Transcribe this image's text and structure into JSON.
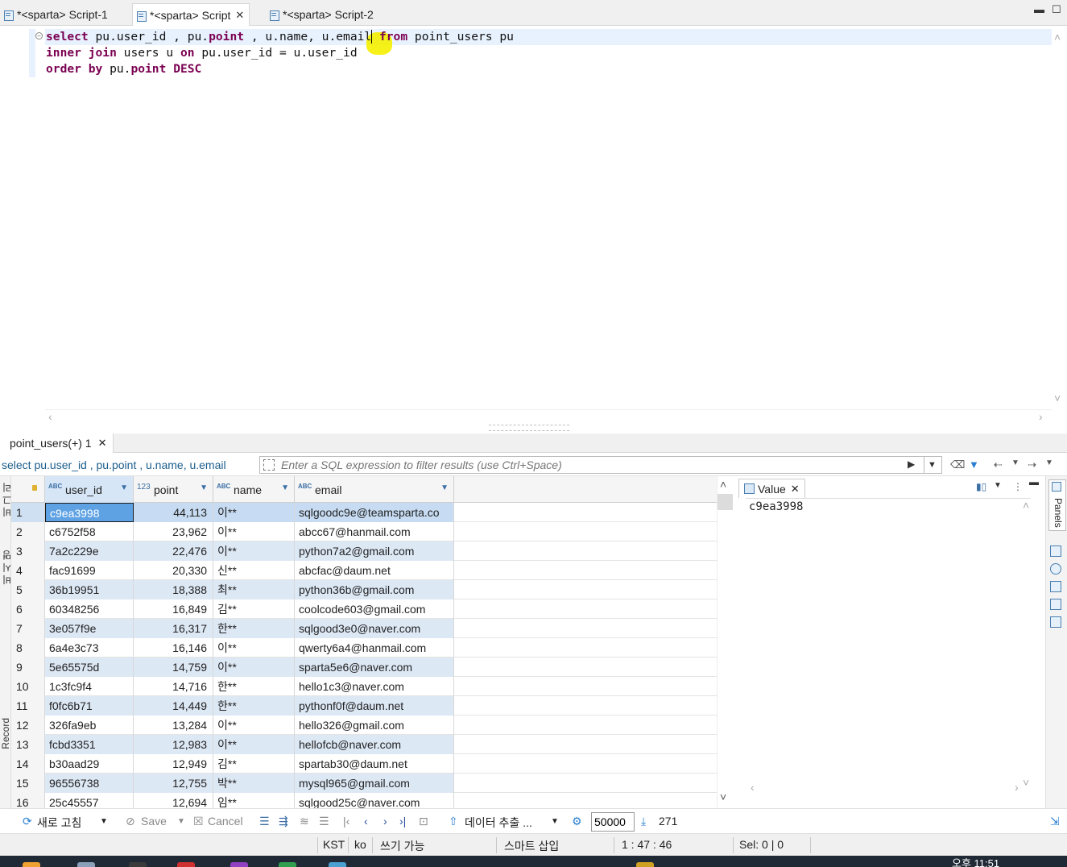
{
  "tabs": [
    {
      "label": "*<sparta> Script-1",
      "active": false,
      "closable": false
    },
    {
      "label": "*<sparta> Script",
      "active": true,
      "closable": true
    },
    {
      "label": "*<sparta> Script-2",
      "active": false,
      "closable": false
    }
  ],
  "editor": {
    "lines": [
      {
        "kw1": "select",
        "t1": " pu.user_id , pu.",
        "kw2": "point",
        "t2": " , u.name, u.email",
        "kw3": "from",
        "t3": " point_users pu"
      },
      {
        "kw1": "inner join",
        "t1": " users u ",
        "kw2": "on",
        "t2": " pu.user_id = u.user_id"
      },
      {
        "kw1": "order by",
        "t1": " pu.",
        "kw2": "point",
        "t2": " ",
        "kw3": "DESC"
      }
    ]
  },
  "results": {
    "tab_label": "point_users(+) 1",
    "query_preview": "select pu.user_id , pu.point , u.name, u.email",
    "filter_placeholder": "Enter a SQL expression to filter results (use Ctrl+Space)",
    "columns": [
      {
        "type": "ABC",
        "name": "user_id"
      },
      {
        "type": "123",
        "name": "point"
      },
      {
        "type": "ABC",
        "name": "name"
      },
      {
        "type": "ABC",
        "name": "email"
      }
    ],
    "rows": [
      {
        "n": "1",
        "user_id": "c9ea3998",
        "point": "44,113",
        "name": "이**",
        "email": "sqlgoodc9e@teamsparta.co"
      },
      {
        "n": "2",
        "user_id": "c6752f58",
        "point": "23,962",
        "name": "이**",
        "email": "abcc67@hanmail.com"
      },
      {
        "n": "3",
        "user_id": "7a2c229e",
        "point": "22,476",
        "name": "이**",
        "email": "python7a2@gmail.com"
      },
      {
        "n": "4",
        "user_id": "fac91699",
        "point": "20,330",
        "name": "신**",
        "email": "abcfac@daum.net"
      },
      {
        "n": "5",
        "user_id": "36b19951",
        "point": "18,388",
        "name": "최**",
        "email": "python36b@gmail.com"
      },
      {
        "n": "6",
        "user_id": "60348256",
        "point": "16,849",
        "name": "김**",
        "email": "coolcode603@gmail.com"
      },
      {
        "n": "7",
        "user_id": "3e057f9e",
        "point": "16,317",
        "name": "한**",
        "email": "sqlgood3e0@naver.com"
      },
      {
        "n": "8",
        "user_id": "6a4e3c73",
        "point": "16,146",
        "name": "이**",
        "email": "qwerty6a4@hanmail.com"
      },
      {
        "n": "9",
        "user_id": "5e65575d",
        "point": "14,759",
        "name": "이**",
        "email": "sparta5e6@naver.com"
      },
      {
        "n": "10",
        "user_id": "1c3fc9f4",
        "point": "14,716",
        "name": "한**",
        "email": "hello1c3@naver.com"
      },
      {
        "n": "11",
        "user_id": "f0fc6b71",
        "point": "14,449",
        "name": "한**",
        "email": "pythonf0f@daum.net"
      },
      {
        "n": "12",
        "user_id": "326fa9eb",
        "point": "13,284",
        "name": "이**",
        "email": "hello326@gmail.com"
      },
      {
        "n": "13",
        "user_id": "fcbd3351",
        "point": "12,983",
        "name": "이**",
        "email": "hellofcb@naver.com"
      },
      {
        "n": "14",
        "user_id": "b30aad29",
        "point": "12,949",
        "name": "김**",
        "email": "spartab30@daum.net"
      },
      {
        "n": "15",
        "user_id": "96556738",
        "point": "12,755",
        "name": "박**",
        "email": "mysql965@gmail.com"
      },
      {
        "n": "16",
        "user_id": "25c45557",
        "point": "12,694",
        "name": "임**",
        "email": "sqlgood25c@naver.com"
      }
    ],
    "selected_row": 0
  },
  "value_panel": {
    "tab_label": "Value",
    "value": "c9ea3998",
    "side_tab_label": "Panels"
  },
  "left_strip": {
    "top_text": "비 그 리",
    "mid_text": "비 시 명",
    "record_label": "Record"
  },
  "toolbar": {
    "refresh_label": "새로 고침",
    "save_label": "Save",
    "cancel_label": "Cancel",
    "export_label": "데이터 추출 ...",
    "fetch_size": "50000",
    "row_count": "271"
  },
  "status": {
    "timezone": "KST",
    "locale": "ko",
    "write_mode": "쓰기 가능",
    "insert_mode": "스마트 삽입",
    "cursor_pos": "1 : 47 : 46",
    "selection": "Sel: 0 | 0"
  },
  "taskbar": {
    "clock": "오후 11:51"
  },
  "colors": {
    "keyword": "#7b0052",
    "row_alt": "#dde8f5",
    "selection": "#5ea2e4",
    "cursor_highlight": "#f4f000"
  }
}
